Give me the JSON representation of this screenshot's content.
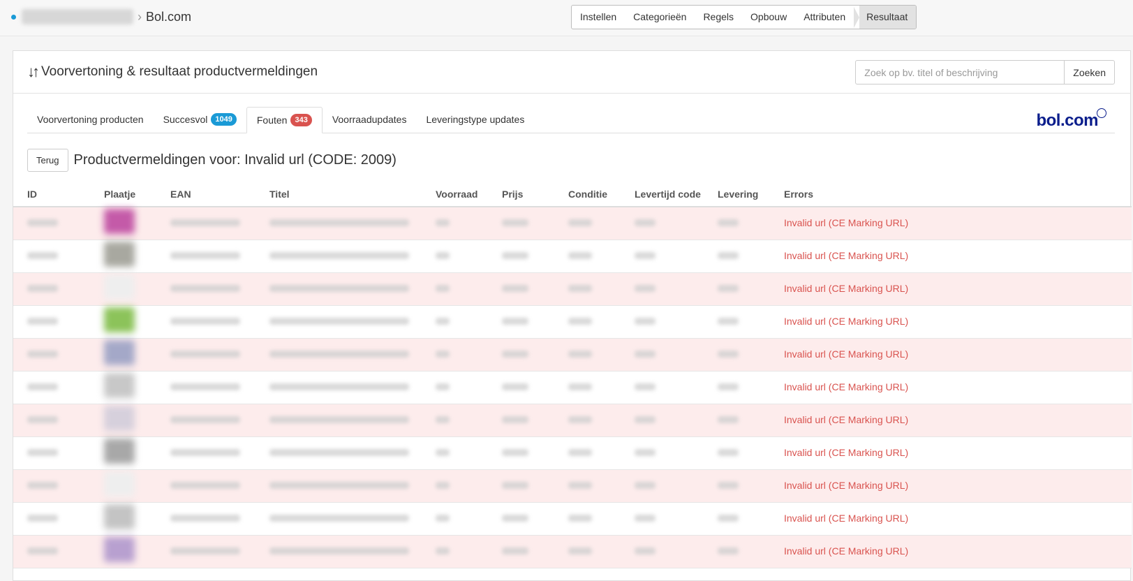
{
  "breadcrumb": {
    "current": "Bol.com"
  },
  "steps": [
    "Instellen",
    "Categorieën",
    "Regels",
    "Opbouw",
    "Attributen",
    "Resultaat"
  ],
  "panel": {
    "title": "Voorvertoning & resultaat productvermeldingen",
    "search_placeholder": "Zoek op bv. titel of beschrijving",
    "search_button": "Zoeken"
  },
  "tabs": [
    {
      "label": "Voorvertoning producten"
    },
    {
      "label": "Succesvol",
      "badge": "1049"
    },
    {
      "label": "Fouten",
      "badge": "343"
    },
    {
      "label": "Voorraadupdates"
    },
    {
      "label": "Leveringstype updates"
    }
  ],
  "logo": "bol.com",
  "back_button": "Terug",
  "subtitle": "Productvermeldingen voor: Invalid url (CODE: 2009)",
  "table": {
    "columns": [
      "ID",
      "Plaatje",
      "EAN",
      "Titel",
      "Voorraad",
      "Prijs",
      "Conditie",
      "Levertijd code",
      "Levering",
      "Errors"
    ],
    "rows": [
      {
        "error": "Invalid url (CE Marking URL)",
        "thumb_color": "#c45aa8"
      },
      {
        "error": "Invalid url (CE Marking URL)",
        "thumb_color": "#a8a8a0"
      },
      {
        "error": "Invalid url (CE Marking URL)",
        "thumb_color": "#eeeeee"
      },
      {
        "error": "Invalid url (CE Marking URL)",
        "thumb_color": "#8cc35a"
      },
      {
        "error": "Invalid url (CE Marking URL)",
        "thumb_color": "#a4a8c8"
      },
      {
        "error": "Invalid url (CE Marking URL)",
        "thumb_color": "#c8c8c8"
      },
      {
        "error": "Invalid url (CE Marking URL)",
        "thumb_color": "#d6d0dc"
      },
      {
        "error": "Invalid url (CE Marking URL)",
        "thumb_color": "#a8a8a8"
      },
      {
        "error": "Invalid url (CE Marking URL)",
        "thumb_color": "#eeeeee"
      },
      {
        "error": "Invalid url (CE Marking URL)",
        "thumb_color": "#c4c4c4"
      },
      {
        "error": "Invalid url (CE Marking URL)",
        "thumb_color": "#b8a0d0"
      }
    ]
  }
}
